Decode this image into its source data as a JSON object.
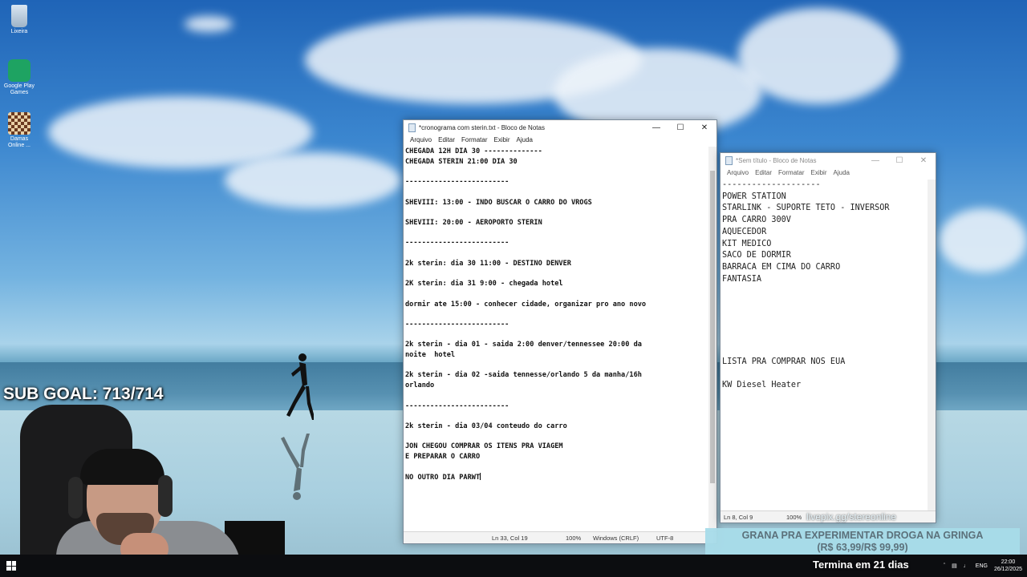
{
  "desktop": {
    "icons": [
      {
        "label": "Lixeira",
        "icon": "recycle-bin-icon"
      },
      {
        "label": "Google Play Games",
        "icon": "google-play-games-icon"
      },
      {
        "label": "Damas Online ...",
        "icon": "checkers-icon"
      }
    ]
  },
  "overlay": {
    "sub_goal": "SUB GOAL: 713/714",
    "livepix": "livepix.gg/stereonline",
    "banner_line1": "GRANA PRA EXPERIMENTAR DROGA NA GRINGA",
    "banner_line2": "(R$ 63,99/R$ 99,99)",
    "countdown": "Termina em 21 dias"
  },
  "notepad1": {
    "title": "*cronograma com sterin.txt - Bloco de Notas",
    "menu": [
      "Arquivo",
      "Editar",
      "Formatar",
      "Exibir",
      "Ajuda"
    ],
    "lines": [
      "CHEGADA 12H DIA 30 --------------",
      "CHEGADA STERIN 21:00 DIA 30",
      "",
      "-------------------------",
      "",
      "SHEVIII: 13:00 - INDO BUSCAR O CARRO DO VROGS",
      "",
      "SHEVIII: 20:00 - AEROPORTO STERIN",
      "",
      "-------------------------",
      "",
      "2k sterin: dia 30 11:00 - DESTINO DENVER",
      "",
      "2K sterin: dia 31 9:00 - chegada hotel",
      "",
      "dormir ate 15:00 - conhecer cidade, organizar pro ano novo",
      "",
      "-------------------------",
      "",
      "2k sterin - dia 01 - saida 2:00 denver/tennessee 20:00 da",
      "noite  hotel",
      "",
      "2k sterin - dia 02 -saida tennesse/orlando 5 da manha/16h",
      "orlando",
      "",
      "-------------------------",
      "",
      "2k sterin - dia 03/04 conteudo do carro",
      "",
      "JON CHEGOU COMPRAR OS ITENS PRA VIAGEM",
      "E PREPARAR O CARRO",
      "",
      "NO OUTRO DIA PARWT"
    ],
    "status": {
      "position": "Ln 33, Col 19",
      "zoom": "100%",
      "eol": "Windows (CRLF)",
      "encoding": "UTF-8"
    }
  },
  "notepad2": {
    "title": "*Sem título - Bloco de Notas",
    "menu": [
      "Arquivo",
      "Editar",
      "Formatar",
      "Exibir",
      "Ajuda"
    ],
    "lines": [
      "--------------------",
      "POWER STATION",
      "STARLINK - SUPORTE TETO - INVERSOR",
      "PRA CARRO 300V",
      "AQUECEDOR",
      "KIT MEDICO",
      "SACO DE DORMIR",
      "BARRACA EM CIMA DO CARRO",
      "FANTASIA",
      "",
      "",
      "",
      "",
      "",
      "",
      "LISTA PRA COMPRAR NOS EUA",
      "",
      "KW Diesel Heater"
    ],
    "status": {
      "position": "Ln 8, Col 9",
      "zoom": "100%"
    }
  },
  "taskbar": {
    "lang": "ENG",
    "time": "22:00",
    "date": "26/12/2025"
  }
}
